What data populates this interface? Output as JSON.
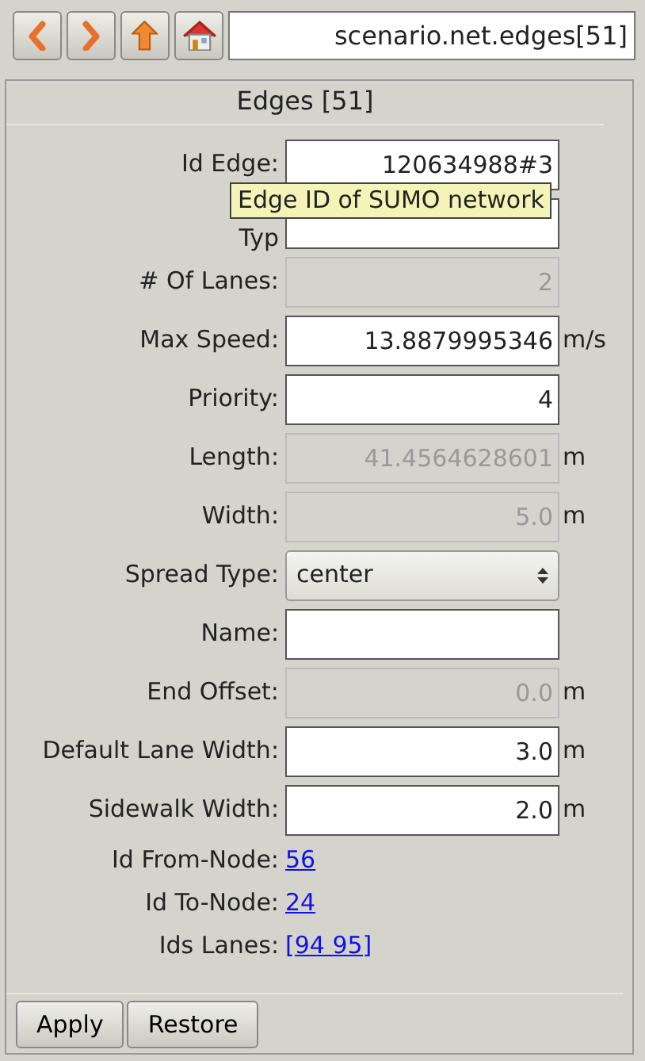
{
  "toolbar": {
    "path": "scenario.net.edges[51]"
  },
  "panel": {
    "title": "Edges [51]",
    "fields": [
      {
        "kind": "input",
        "label": "Id Edge:",
        "value": "120634988#3",
        "disabled": false
      },
      {
        "kind": "input",
        "label": "Typ",
        "disabled": false
      },
      {
        "kind": "input",
        "label": "# Of Lanes:",
        "value": "2",
        "disabled": true
      },
      {
        "kind": "input",
        "label": "Max Speed:",
        "value": "13.8879995346",
        "unit": "m/s",
        "disabled": false
      },
      {
        "kind": "input",
        "label": "Priority:",
        "value": "4",
        "disabled": false
      },
      {
        "kind": "input",
        "label": "Length:",
        "value": "41.4564628601",
        "unit": "m",
        "disabled": true
      },
      {
        "kind": "input",
        "label": "Width:",
        "value": "5.0",
        "unit": "m",
        "disabled": true
      },
      {
        "kind": "select",
        "label": "Spread Type:",
        "value": "center",
        "disabled": false
      },
      {
        "kind": "input",
        "label": "Name:",
        "disabled": false
      },
      {
        "kind": "input",
        "label": "End Offset:",
        "value": "0.0",
        "unit": "m",
        "disabled": true
      },
      {
        "kind": "input",
        "label": "Default Lane Width:",
        "value": "3.0",
        "unit": "m",
        "disabled": false
      },
      {
        "kind": "input",
        "label": "Sidewalk Width:",
        "value": "2.0",
        "unit": "m",
        "disabled": false
      },
      {
        "kind": "link",
        "label": "Id From-Node:",
        "value": "56"
      },
      {
        "kind": "link",
        "label": "Id To-Node:",
        "value": "24"
      },
      {
        "kind": "link",
        "label": "Ids Lanes:",
        "value": "[94 95]"
      }
    ],
    "tooltip": "Edge ID of SUMO network",
    "buttons": [
      "Apply",
      "Restore"
    ]
  }
}
